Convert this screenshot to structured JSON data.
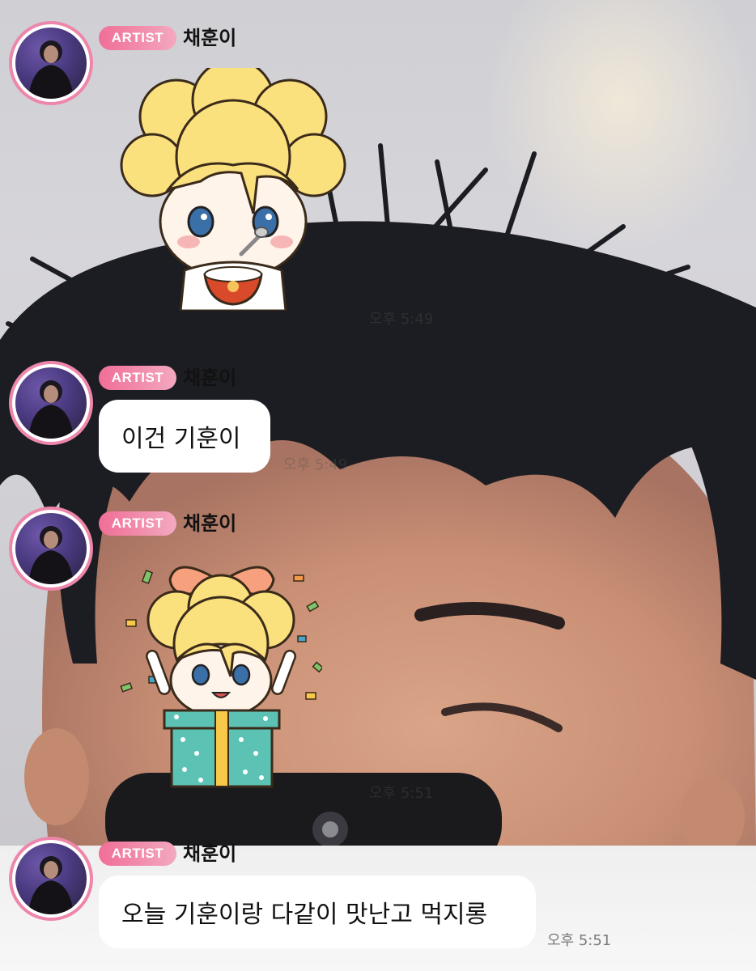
{
  "chat": {
    "messages": [
      {
        "badge": "ARTIST",
        "sender": "채훈이",
        "type": "sticker",
        "sticker": "eating-rice-sticker",
        "time": "오후 5:49"
      },
      {
        "badge": "ARTIST",
        "sender": "채훈이",
        "type": "text",
        "text": "이건 기훈이",
        "time": "오후 5:49"
      },
      {
        "badge": "ARTIST",
        "sender": "채훈이",
        "type": "sticker",
        "sticker": "gift-box-sticker",
        "time": "오후 5:51"
      },
      {
        "badge": "ARTIST",
        "sender": "채훈이",
        "type": "text",
        "text": "오늘 기훈이랑 다같이 맛난고 먹지롱",
        "time": "오후 5:51"
      }
    ]
  },
  "colors": {
    "badge_start": "#f06e97",
    "badge_end": "#f3a9bf",
    "avatar_ring": "#ee86ab",
    "bubble": "#ffffff"
  }
}
